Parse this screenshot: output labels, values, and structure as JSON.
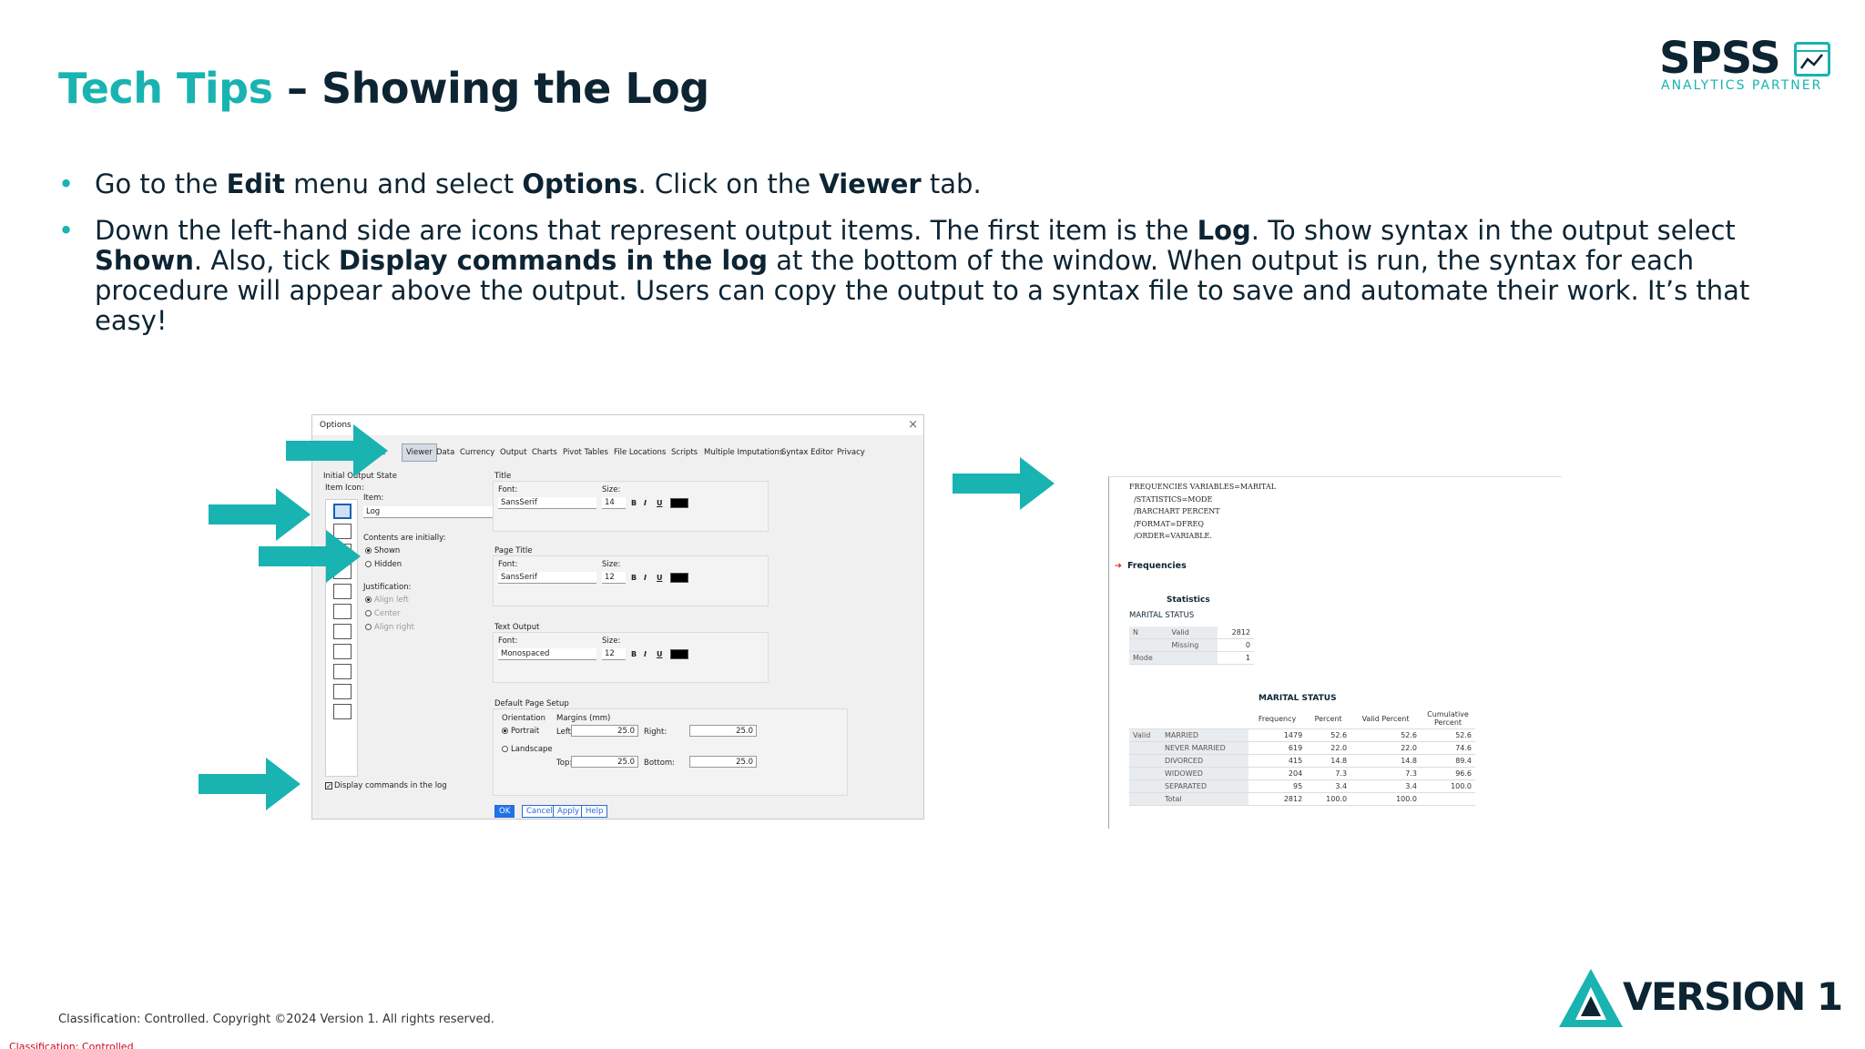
{
  "title": {
    "accent": "Tech Tips",
    "rest": " – Showing the Log"
  },
  "logo": {
    "word": "SPSS",
    "tagline": "ANALYTICS PARTNER"
  },
  "bullets": [
    {
      "parts": [
        "Go to the ",
        "Edit",
        " menu and select ",
        "Options",
        ". Click on the ",
        "Viewer",
        " tab."
      ]
    },
    {
      "parts": [
        "Down the left-hand side are icons that represent output items. The first item is the ",
        "Log",
        ". To show syntax in the output select ",
        "Shown",
        ". Also, tick ",
        "Display commands in the log",
        " at the bottom of the window. When output is run, the syntax for each procedure will appear above the output. Users can copy the output to a syntax file to save and automate their work. It’s that easy!"
      ]
    }
  ],
  "dialog": {
    "title": "Options",
    "close": "×",
    "tabs": [
      "ge",
      "Viewer",
      "Data",
      "Currency",
      "Output",
      "Charts",
      "Pivot Tables",
      "File Locations",
      "Scripts",
      "Multiple Imputations",
      "Syntax Editor",
      "Privacy"
    ],
    "initial_output_state": "Initial Output State",
    "item_icon": "Item Icon:",
    "item_label": "Item:",
    "item_value": "Log",
    "contents_label": "Contents are initially:",
    "shown": "Shown",
    "hidden": "Hidden",
    "justification": "Justification:",
    "align_left": "Align left",
    "center": "Center",
    "align_right": "Align right",
    "title_group": "Title",
    "page_title_group": "Page Title",
    "text_output_group": "Text Output",
    "font_label": "Font:",
    "size_label": "Size:",
    "title_font": "SansSerif",
    "title_size": "14",
    "page_font": "SansSerif",
    "page_size": "12",
    "text_font": "Monospaced",
    "text_size": "12",
    "bold": "B",
    "italic": "I",
    "underline": "U",
    "default_page_setup": "Default Page Setup",
    "orientation": "Orientation",
    "portrait": "Portrait",
    "landscape": "Landscape",
    "margins": "Margins (mm)",
    "left": "Left:",
    "right": "Right:",
    "top": "Top:",
    "bottom": "Bottom:",
    "margin_left": "25.0",
    "margin_right": "25.0",
    "margin_top": "25.0",
    "margin_bottom": "25.0",
    "display_commands": "Display commands in the log",
    "checkmark": "✓",
    "buttons": {
      "ok": "OK",
      "cancel": "Cancel",
      "apply": "Apply",
      "help": "Help"
    }
  },
  "viewer": {
    "syntax": "FREQUENCIES VARIABLES=MARITAL\n  /STATISTICS=MODE\n  /BARCHART PERCENT\n  /FORMAT=DFREQ\n  /ORDER=VARIABLE.",
    "frequencies_arrow": "➔",
    "frequencies": "Frequencies",
    "statistics_title": "Statistics",
    "statistics_var": "MARITAL STATUS",
    "statistics_rows": [
      {
        "a": "N",
        "b": "Valid",
        "v": "2812"
      },
      {
        "a": "",
        "b": "Missing",
        "v": "0"
      },
      {
        "a": "Mode",
        "b": "",
        "v": "1"
      }
    ],
    "marital_title": "MARITAL STATUS",
    "marital_headers": [
      "Frequency",
      "Percent",
      "Valid Percent",
      "Cumulative Percent"
    ],
    "valid_label": "Valid",
    "marital_rows": [
      {
        "label": "MARRIED",
        "f": "1479",
        "p": "52.6",
        "vp": "52.6",
        "cp": "52.6"
      },
      {
        "label": "NEVER MARRIED",
        "f": "619",
        "p": "22.0",
        "vp": "22.0",
        "cp": "74.6"
      },
      {
        "label": "DIVORCED",
        "f": "415",
        "p": "14.8",
        "vp": "14.8",
        "cp": "89.4"
      },
      {
        "label": "WIDOWED",
        "f": "204",
        "p": "7.3",
        "vp": "7.3",
        "cp": "96.6"
      },
      {
        "label": "SEPARATED",
        "f": "95",
        "p": "3.4",
        "vp": "3.4",
        "cp": "100.0"
      },
      {
        "label": "Total",
        "f": "2812",
        "p": "100.0",
        "vp": "100.0",
        "cp": ""
      }
    ]
  },
  "footer": {
    "copyright": "Classification: Controlled. Copyright ©2024 Version 1. All rights reserved.",
    "classification": "Classification: Controlled",
    "version_logo": "VERSION 1"
  },
  "colors": {
    "accent": "#19b3b1",
    "navy": "#0d2433",
    "red": "#d0021b"
  }
}
